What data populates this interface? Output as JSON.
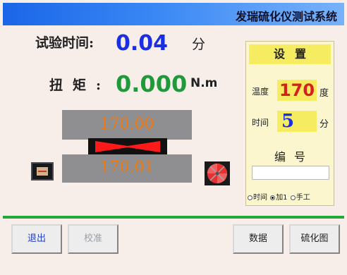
{
  "window": {
    "title": "发瑞硫化仪测试系统"
  },
  "readout": {
    "time_label": "试验时间:",
    "time_value": "0.04",
    "time_unit": "分",
    "torque_label": "扭矩:",
    "torque_value": "0.000",
    "torque_unit": "N.m"
  },
  "dies": {
    "upper_temp": "170.00",
    "lower_temp": "170.01"
  },
  "settings": {
    "header": "设置",
    "temp_label": "温度",
    "temp_value": "170",
    "temp_unit": "度",
    "time_label": "时间",
    "time_value": "5",
    "time_unit": "分",
    "number_label": "编号",
    "number_value": "",
    "mode_options": [
      {
        "label": "时间",
        "selected": false
      },
      {
        "label": "加1",
        "selected": true
      },
      {
        "label": "手工",
        "selected": false
      }
    ]
  },
  "buttons": {
    "exit": "退出",
    "calibrate": "校准",
    "data": "数据",
    "cure_curve": "硫化图"
  },
  "colors": {
    "time_value": "#1a2fe0",
    "torque_value": "#1e9a3a",
    "die_temp": "#f07a10",
    "set_temp": "#d42020",
    "set_time": "#1a2fe0",
    "separator": "#22a83a"
  }
}
